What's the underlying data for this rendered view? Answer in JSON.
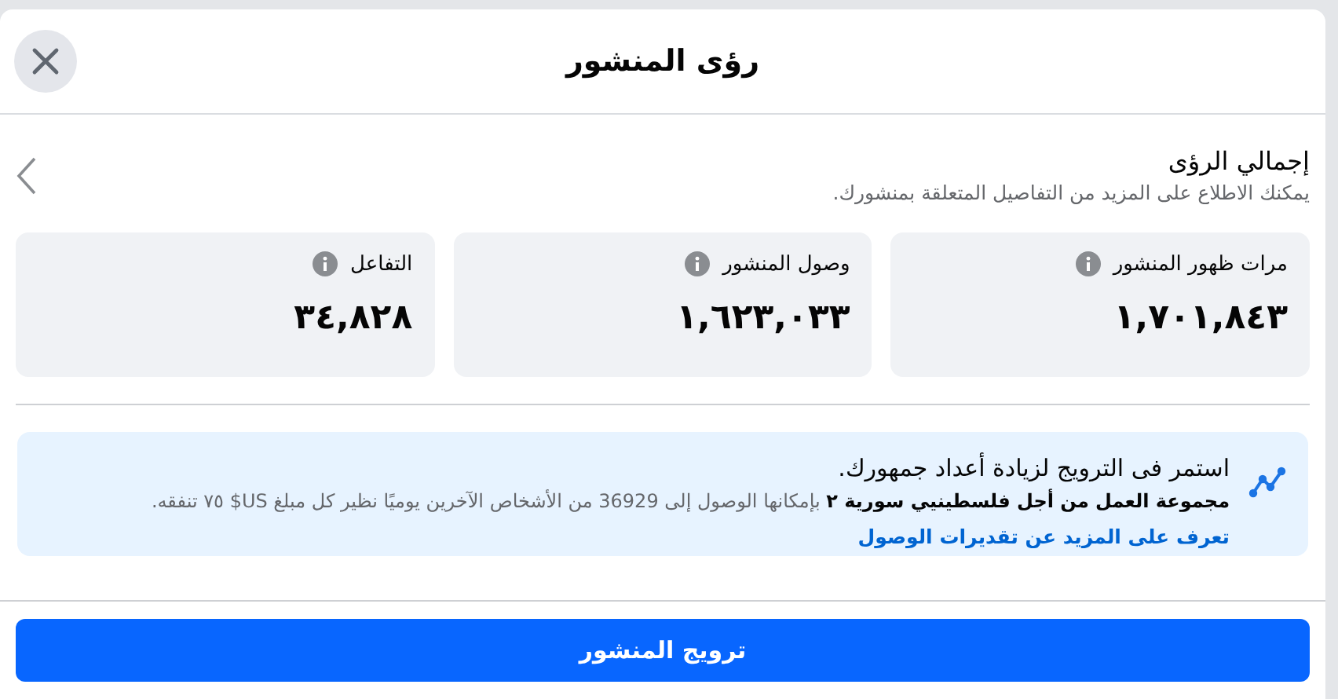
{
  "dialog": {
    "title": "رؤى المنشور"
  },
  "overview": {
    "title": "إجمالي الرؤى",
    "subtitle": "يمكنك الاطلاع على المزيد من التفاصيل المتعلقة بمنشورك."
  },
  "metrics": [
    {
      "label": "مرات ظهور المنشور",
      "value": "١,٧٠١,٨٤٣"
    },
    {
      "label": "وصول المنشور",
      "value": "١,٦٢٣,٠٣٣"
    },
    {
      "label": "التفاعل",
      "value": "٣٤,٨٢٨"
    }
  ],
  "promo": {
    "title": "استمر فى الترويج لزيادة أعداد جمهورك.",
    "body": "**مجموعة العمل من أجل فلسطينيي سورية ٢** بإمكانها الوصول إلى 36929 من الأشخاص الآخرين يوميًا نظير كل مبلغ US$ ٧٥ تنفقه.",
    "link": "تعرف على المزيد عن تقديرات الوصول"
  },
  "button": "ترويج المنشور"
}
